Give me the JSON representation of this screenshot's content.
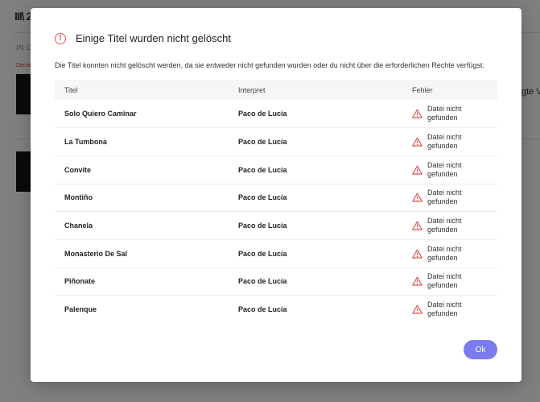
{
  "background": {
    "logo": "III\\ 2",
    "section_label": "IN D",
    "red_label": "Derze",
    "right_text": "gte Ve"
  },
  "modal": {
    "title": "Einige Titel wurden nicht gelöscht",
    "icon": "alert-circle-icon",
    "description": "Die Titel konnten nicht gelöscht werden, da sie entweder nicht gefunden wurden oder du nicht über die erforderlichen Rechte verfügst.",
    "columns": [
      "Titel",
      "Interpret",
      "Fehler"
    ],
    "rows": [
      {
        "title": "Solo Quiero Caminar",
        "artist": "Paco de Lucía",
        "error": "Datei nicht gefunden"
      },
      {
        "title": "La Tumbona",
        "artist": "Paco de Lucía",
        "error": "Datei nicht gefunden"
      },
      {
        "title": "Convite",
        "artist": "Paco de Lucía",
        "error": "Datei nicht gefunden"
      },
      {
        "title": "Montiño",
        "artist": "Paco de Lucía",
        "error": "Datei nicht gefunden"
      },
      {
        "title": "Chanela",
        "artist": "Paco de Lucía",
        "error": "Datei nicht gefunden"
      },
      {
        "title": "Monasterio De Sal",
        "artist": "Paco de Lucía",
        "error": "Datei nicht gefunden"
      },
      {
        "title": "Piñonate",
        "artist": "Paco de Lucía",
        "error": "Datei nicht gefunden"
      },
      {
        "title": "Palenque",
        "artist": "Paco de Lucía",
        "error": "Datei nicht gefunden"
      }
    ],
    "ok_label": "Ok"
  },
  "colors": {
    "accent": "#7b7bf0",
    "error": "#d9534f"
  }
}
